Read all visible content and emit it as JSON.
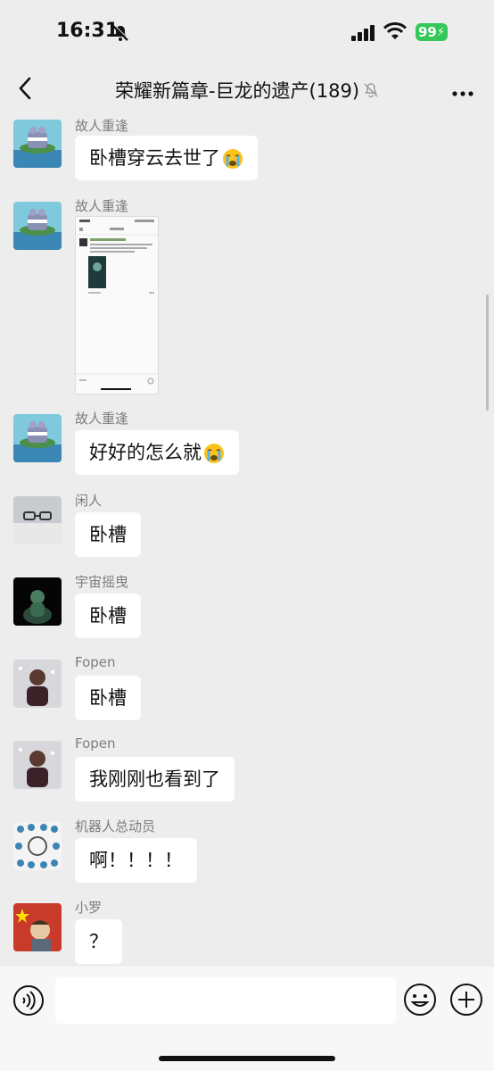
{
  "status": {
    "time": "16:31",
    "battery": "99"
  },
  "header": {
    "title": "荣耀新篇章-巨龙的遗产(189)"
  },
  "messages": [
    {
      "sender": "故人重逢",
      "text": "卧槽穿云去世了",
      "emoji": "loudly-crying-emoji"
    },
    {
      "sender": "故人重逢",
      "type": "image"
    },
    {
      "sender": "故人重逢",
      "text": "好好的怎么就",
      "emoji": "loudly-crying-emoji"
    },
    {
      "sender": "闲人",
      "text": "卧槽"
    },
    {
      "sender": "宇宙摇曳",
      "text": "卧槽"
    },
    {
      "sender": "Fopen",
      "text": "卧槽"
    },
    {
      "sender": "Fopen",
      "text": "我刚刚也看到了"
    },
    {
      "sender": "机器人总动员",
      "text": "啊！！！！"
    },
    {
      "sender": "小罗",
      "text": "？"
    }
  ],
  "input": {
    "value": ""
  },
  "icons": {
    "back": "chevron-left-icon",
    "more": "more-dots-icon",
    "voice": "voice-icon",
    "emoji": "emoji-icon",
    "plus": "plus-icon",
    "mute": "bell-off-icon"
  },
  "colors": {
    "background": "#ededed",
    "bubble": "#ffffff",
    "battery": "#34c759",
    "sender": "#7d7d7d"
  }
}
